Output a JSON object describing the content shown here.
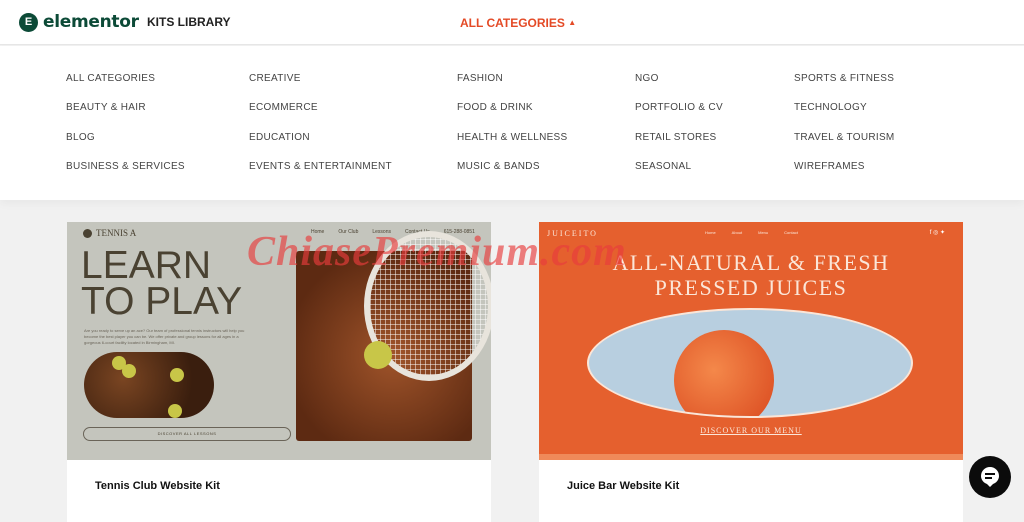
{
  "header": {
    "logo_text": "elementor",
    "logo_mark": "E",
    "section": "KITS LIBRARY",
    "category_toggle": "ALL CATEGORIES",
    "category_toggle_icon": "caret-up-icon",
    "accent_color": "#e44a26",
    "brand_color": "#0c4a37"
  },
  "categories": [
    [
      "ALL CATEGORIES",
      "BEAUTY & HAIR",
      "BLOG",
      "BUSINESS & SERVICES"
    ],
    [
      "CREATIVE",
      "ECOMMERCE",
      "EDUCATION",
      "EVENTS & ENTERTAINMENT"
    ],
    [
      "FASHION",
      "FOOD & DRINK",
      "HEALTH & WELLNESS",
      "MUSIC & BANDS"
    ],
    [
      "NGO",
      "PORTFOLIO & CV",
      "RETAIL STORES",
      "SEASONAL"
    ],
    [
      "SPORTS & FITNESS",
      "TECHNOLOGY",
      "TRAVEL & TOURISM",
      "WIREFRAMES"
    ]
  ],
  "kits": [
    {
      "title": "Tennis Club Website Kit",
      "preview": {
        "brand": "TENNIS A",
        "nav": [
          "Home",
          "Our Club",
          "Lessons",
          "Contact Us",
          "615-288-0851"
        ],
        "headline_1": "LEARN",
        "headline_2": "TO PLAY",
        "body": "Are you ready to serve up an ace? Our team of professional tennis instructors will help you become the best player you can be. We offer private and group lessons for all ages in a gorgeous 6-court facility located in Birmingham, MI.",
        "button": "DISCOVER ALL LESSONS"
      }
    },
    {
      "title": "Juice Bar Website Kit",
      "preview": {
        "brand": "JUICEITO",
        "nav": [
          "Home",
          "About",
          "Menu",
          "Contact"
        ],
        "social": "f ◎ ✦",
        "headline_1": "ALL-NATURAL & FRESH",
        "headline_2": "PRESSED JUICES",
        "link": "DISCOVER OUR MENU"
      }
    }
  ],
  "watermark": "ChiasePremium.com",
  "chat": {
    "icon": "chat-bubble-icon"
  }
}
